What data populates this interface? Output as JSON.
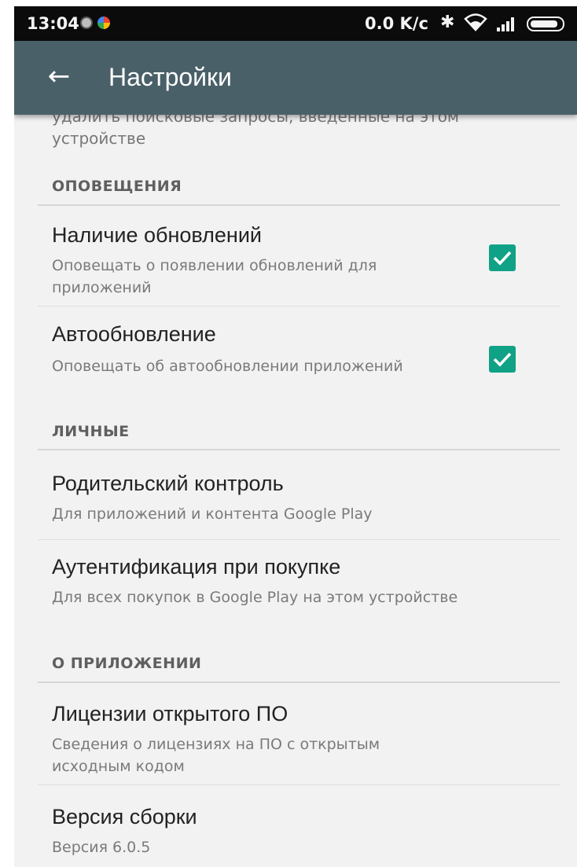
{
  "status_bar": {
    "time": "13:04",
    "speed": "0.0 K/c"
  },
  "toolbar": {
    "title": "Настройки"
  },
  "partial_item": {
    "subtitle": "удалить поисковые запросы, введенные на этом устройстве"
  },
  "sections": {
    "notifications": {
      "header": "ОПОВЕЩЕНИЯ",
      "items": [
        {
          "title": "Наличие обновлений",
          "subtitle": "Оповещать о появлении обновлений для приложений",
          "checked": true
        },
        {
          "title": "Автообновление",
          "subtitle": "Оповещать об автообновлении приложений",
          "checked": true
        }
      ]
    },
    "personal": {
      "header": "ЛИЧНЫЕ",
      "items": [
        {
          "title": "Родительский контроль",
          "subtitle": "Для приложений и контента Google Play"
        },
        {
          "title": "Аутентификация при покупке",
          "subtitle": "Для всех покупок в Google Play на этом устройстве"
        }
      ]
    },
    "about": {
      "header": "О ПРИЛОЖЕНИИ",
      "items": [
        {
          "title": "Лицензии открытого ПО",
          "subtitle": "Сведения о лицензиях на ПО с открытым исходным кодом"
        },
        {
          "title": "Версия сборки",
          "subtitle": "Версия 6.0.5"
        }
      ]
    }
  },
  "colors": {
    "toolbar": "#4a6069",
    "checkbox": "#10a286",
    "status_bar": "#0b0b0b"
  }
}
